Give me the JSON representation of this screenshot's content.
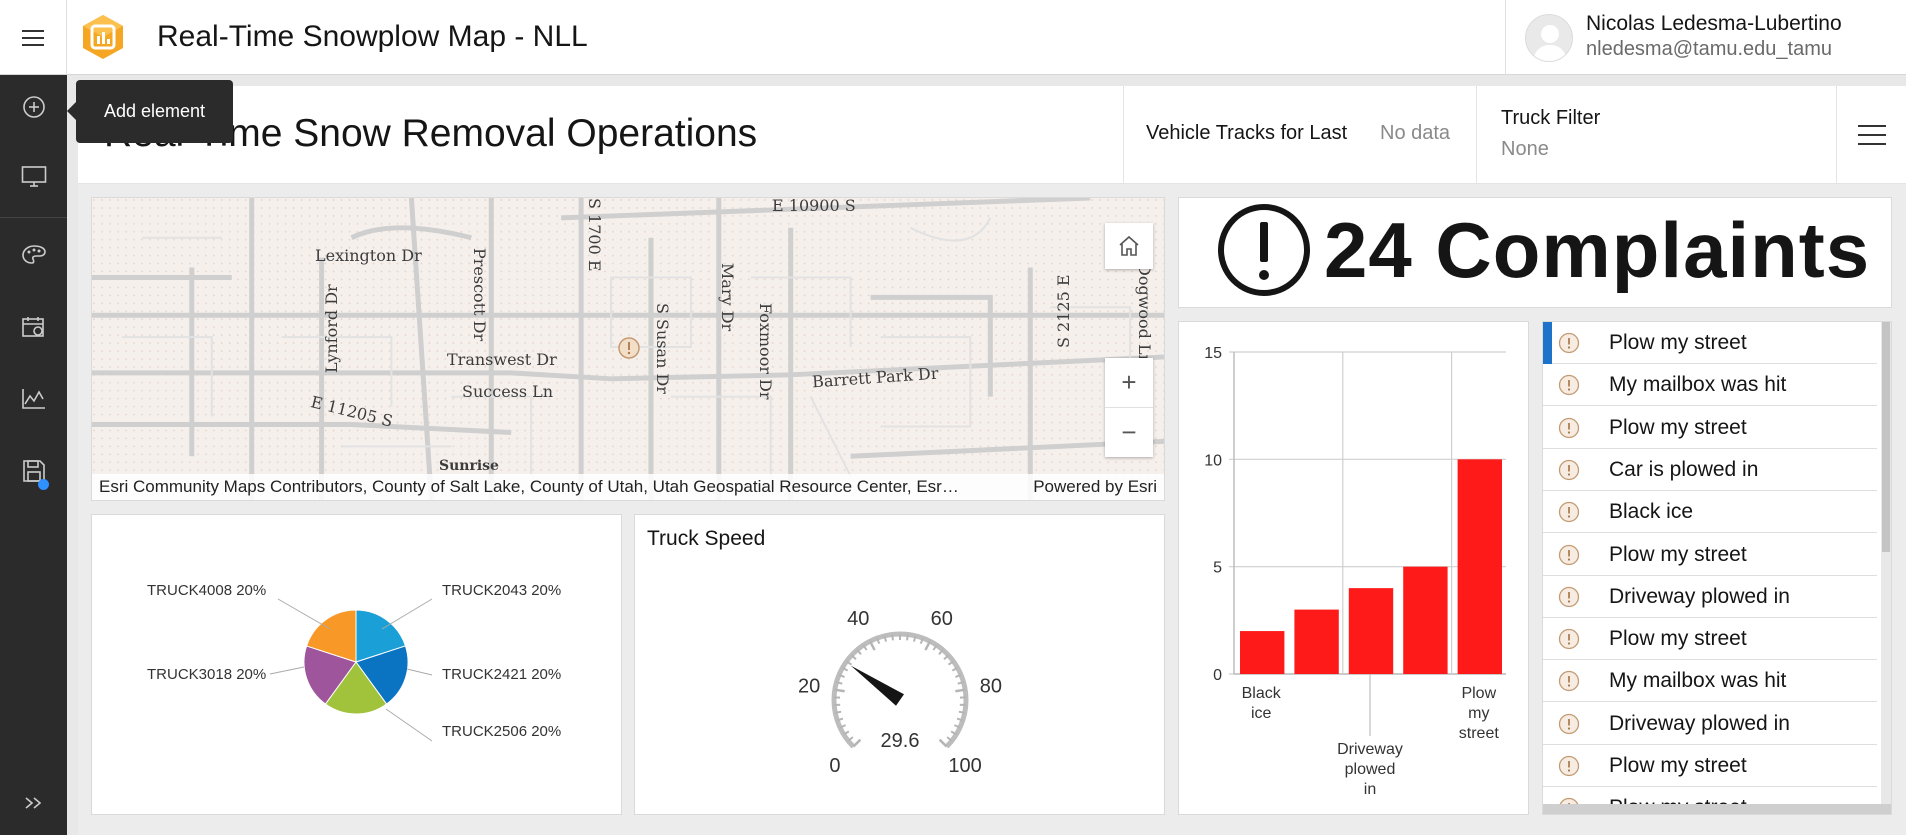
{
  "header": {
    "app_title": "Real-Time Snowplow Map - NLL",
    "user_name": "Nicolas Ledesma-Lubertino",
    "user_email": "nledesma@tamu.edu_tamu"
  },
  "rail": {
    "items": [
      "add-element",
      "layout",
      "theme",
      "settings",
      "analytics",
      "save",
      "expand"
    ]
  },
  "tooltip": {
    "text": "Add element"
  },
  "dashboard": {
    "title": "Real-Time Snow Removal Operations",
    "selector_tracks": {
      "label": "Vehicle Tracks for Last",
      "value": "No data"
    },
    "selector_truck": {
      "label": "Truck Filter",
      "value": "None"
    }
  },
  "map": {
    "streets": [
      "Lexington Dr",
      "Prescott Dr",
      "S 1700 E",
      "E 10900 S",
      "Mary Dr",
      "Foxmoor Dr",
      "Lynford Dr",
      "Transwest Dr",
      "Success Ln",
      "S Susan Dr",
      "Barrett Park Dr",
      "E 11205 S",
      "S 2125 E",
      "Sunrise",
      "Dogwood Ln"
    ],
    "attribution_left": "Esri Community Maps Contributors, County of Salt Lake, County of Utah, Utah Geospatial Resource Center, Esr…",
    "attribution_right": "Powered by Esri"
  },
  "indicator": {
    "value_text": "24 Complaints"
  },
  "pie": {
    "labels": [
      "TRUCK4008 20%",
      "TRUCK2043 20%",
      "TRUCK3018 20%",
      "TRUCK2421 20%",
      "TRUCK2506 20%"
    ],
    "colors": [
      "#f89927",
      "#1aa0d6",
      "#9e559c",
      "#0a73c2",
      "#a1c33c"
    ]
  },
  "gauge": {
    "title": "Truck Speed",
    "value": 29.6,
    "value_text": "29.6",
    "min": 0,
    "max": 100,
    "tick_labels": [
      "0",
      "20",
      "40",
      "60",
      "80",
      "100"
    ]
  },
  "chart_data": {
    "type": "bar",
    "categories": [
      "Black ice",
      "Car is plowed in",
      "Driveway plowed in",
      "My mailbox was hit",
      "Plow my street"
    ],
    "values": [
      2,
      3,
      4,
      5,
      10
    ],
    "visible_category_labels": [
      "Black ice",
      "Driveway plowed in",
      "Plow my street"
    ],
    "y_ticks": [
      "0",
      "5",
      "10",
      "15"
    ],
    "ylim": [
      0,
      15
    ],
    "color": "#ff1a1a",
    "grid": true
  },
  "complaints": {
    "items": [
      "Plow my street",
      "My mailbox was hit",
      "Plow my street",
      "Car is plowed in",
      "Black ice",
      "Plow my street",
      "Driveway plowed in",
      "Plow my street",
      "My mailbox was hit",
      "Driveway plowed in",
      "Plow my street",
      "Plow my street"
    ]
  }
}
